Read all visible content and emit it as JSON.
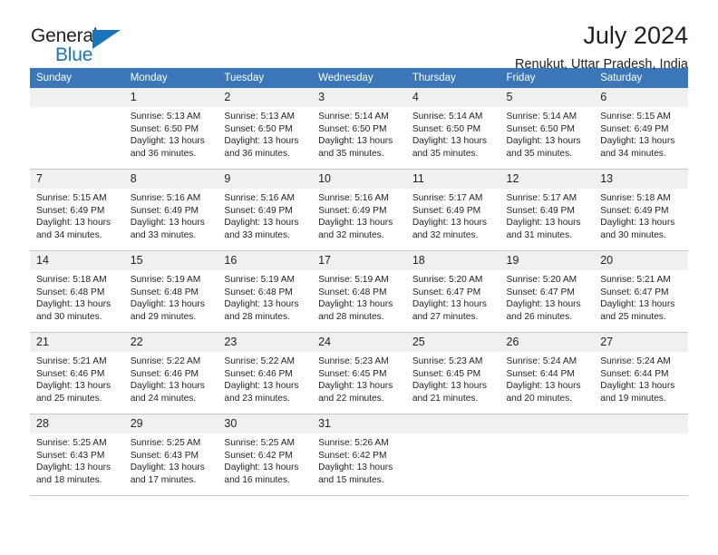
{
  "brand": {
    "name_top": "General",
    "name_bottom": "Blue",
    "triangle_color": "#1b75bb"
  },
  "header": {
    "title": "July 2024",
    "subtitle": "Renukut, Uttar Pradesh, India"
  },
  "theme": {
    "header_blue": "#3a76b8",
    "daynum_bg": "#f0f0f0",
    "grid_line": "#c8c8c8",
    "text": "#231f20"
  },
  "weekdays": [
    "Sunday",
    "Monday",
    "Tuesday",
    "Wednesday",
    "Thursday",
    "Friday",
    "Saturday"
  ],
  "labels": {
    "sunrise_prefix": "Sunrise:",
    "sunset_prefix": "Sunset:",
    "daylight_prefix": "Daylight:"
  },
  "weeks": [
    [
      {
        "day": ""
      },
      {
        "day": "1",
        "sunrise": "Sunrise: 5:13 AM",
        "sunset": "Sunset: 6:50 PM",
        "daylight_l1": "Daylight: 13 hours",
        "daylight_l2": "and 36 minutes."
      },
      {
        "day": "2",
        "sunrise": "Sunrise: 5:13 AM",
        "sunset": "Sunset: 6:50 PM",
        "daylight_l1": "Daylight: 13 hours",
        "daylight_l2": "and 36 minutes."
      },
      {
        "day": "3",
        "sunrise": "Sunrise: 5:14 AM",
        "sunset": "Sunset: 6:50 PM",
        "daylight_l1": "Daylight: 13 hours",
        "daylight_l2": "and 35 minutes."
      },
      {
        "day": "4",
        "sunrise": "Sunrise: 5:14 AM",
        "sunset": "Sunset: 6:50 PM",
        "daylight_l1": "Daylight: 13 hours",
        "daylight_l2": "and 35 minutes."
      },
      {
        "day": "5",
        "sunrise": "Sunrise: 5:14 AM",
        "sunset": "Sunset: 6:50 PM",
        "daylight_l1": "Daylight: 13 hours",
        "daylight_l2": "and 35 minutes."
      },
      {
        "day": "6",
        "sunrise": "Sunrise: 5:15 AM",
        "sunset": "Sunset: 6:49 PM",
        "daylight_l1": "Daylight: 13 hours",
        "daylight_l2": "and 34 minutes."
      }
    ],
    [
      {
        "day": "7",
        "sunrise": "Sunrise: 5:15 AM",
        "sunset": "Sunset: 6:49 PM",
        "daylight_l1": "Daylight: 13 hours",
        "daylight_l2": "and 34 minutes."
      },
      {
        "day": "8",
        "sunrise": "Sunrise: 5:16 AM",
        "sunset": "Sunset: 6:49 PM",
        "daylight_l1": "Daylight: 13 hours",
        "daylight_l2": "and 33 minutes."
      },
      {
        "day": "9",
        "sunrise": "Sunrise: 5:16 AM",
        "sunset": "Sunset: 6:49 PM",
        "daylight_l1": "Daylight: 13 hours",
        "daylight_l2": "and 33 minutes."
      },
      {
        "day": "10",
        "sunrise": "Sunrise: 5:16 AM",
        "sunset": "Sunset: 6:49 PM",
        "daylight_l1": "Daylight: 13 hours",
        "daylight_l2": "and 32 minutes."
      },
      {
        "day": "11",
        "sunrise": "Sunrise: 5:17 AM",
        "sunset": "Sunset: 6:49 PM",
        "daylight_l1": "Daylight: 13 hours",
        "daylight_l2": "and 32 minutes."
      },
      {
        "day": "12",
        "sunrise": "Sunrise: 5:17 AM",
        "sunset": "Sunset: 6:49 PM",
        "daylight_l1": "Daylight: 13 hours",
        "daylight_l2": "and 31 minutes."
      },
      {
        "day": "13",
        "sunrise": "Sunrise: 5:18 AM",
        "sunset": "Sunset: 6:49 PM",
        "daylight_l1": "Daylight: 13 hours",
        "daylight_l2": "and 30 minutes."
      }
    ],
    [
      {
        "day": "14",
        "sunrise": "Sunrise: 5:18 AM",
        "sunset": "Sunset: 6:48 PM",
        "daylight_l1": "Daylight: 13 hours",
        "daylight_l2": "and 30 minutes."
      },
      {
        "day": "15",
        "sunrise": "Sunrise: 5:19 AM",
        "sunset": "Sunset: 6:48 PM",
        "daylight_l1": "Daylight: 13 hours",
        "daylight_l2": "and 29 minutes."
      },
      {
        "day": "16",
        "sunrise": "Sunrise: 5:19 AM",
        "sunset": "Sunset: 6:48 PM",
        "daylight_l1": "Daylight: 13 hours",
        "daylight_l2": "and 28 minutes."
      },
      {
        "day": "17",
        "sunrise": "Sunrise: 5:19 AM",
        "sunset": "Sunset: 6:48 PM",
        "daylight_l1": "Daylight: 13 hours",
        "daylight_l2": "and 28 minutes."
      },
      {
        "day": "18",
        "sunrise": "Sunrise: 5:20 AM",
        "sunset": "Sunset: 6:47 PM",
        "daylight_l1": "Daylight: 13 hours",
        "daylight_l2": "and 27 minutes."
      },
      {
        "day": "19",
        "sunrise": "Sunrise: 5:20 AM",
        "sunset": "Sunset: 6:47 PM",
        "daylight_l1": "Daylight: 13 hours",
        "daylight_l2": "and 26 minutes."
      },
      {
        "day": "20",
        "sunrise": "Sunrise: 5:21 AM",
        "sunset": "Sunset: 6:47 PM",
        "daylight_l1": "Daylight: 13 hours",
        "daylight_l2": "and 25 minutes."
      }
    ],
    [
      {
        "day": "21",
        "sunrise": "Sunrise: 5:21 AM",
        "sunset": "Sunset: 6:46 PM",
        "daylight_l1": "Daylight: 13 hours",
        "daylight_l2": "and 25 minutes."
      },
      {
        "day": "22",
        "sunrise": "Sunrise: 5:22 AM",
        "sunset": "Sunset: 6:46 PM",
        "daylight_l1": "Daylight: 13 hours",
        "daylight_l2": "and 24 minutes."
      },
      {
        "day": "23",
        "sunrise": "Sunrise: 5:22 AM",
        "sunset": "Sunset: 6:46 PM",
        "daylight_l1": "Daylight: 13 hours",
        "daylight_l2": "and 23 minutes."
      },
      {
        "day": "24",
        "sunrise": "Sunrise: 5:23 AM",
        "sunset": "Sunset: 6:45 PM",
        "daylight_l1": "Daylight: 13 hours",
        "daylight_l2": "and 22 minutes."
      },
      {
        "day": "25",
        "sunrise": "Sunrise: 5:23 AM",
        "sunset": "Sunset: 6:45 PM",
        "daylight_l1": "Daylight: 13 hours",
        "daylight_l2": "and 21 minutes."
      },
      {
        "day": "26",
        "sunrise": "Sunrise: 5:24 AM",
        "sunset": "Sunset: 6:44 PM",
        "daylight_l1": "Daylight: 13 hours",
        "daylight_l2": "and 20 minutes."
      },
      {
        "day": "27",
        "sunrise": "Sunrise: 5:24 AM",
        "sunset": "Sunset: 6:44 PM",
        "daylight_l1": "Daylight: 13 hours",
        "daylight_l2": "and 19 minutes."
      }
    ],
    [
      {
        "day": "28",
        "sunrise": "Sunrise: 5:25 AM",
        "sunset": "Sunset: 6:43 PM",
        "daylight_l1": "Daylight: 13 hours",
        "daylight_l2": "and 18 minutes."
      },
      {
        "day": "29",
        "sunrise": "Sunrise: 5:25 AM",
        "sunset": "Sunset: 6:43 PM",
        "daylight_l1": "Daylight: 13 hours",
        "daylight_l2": "and 17 minutes."
      },
      {
        "day": "30",
        "sunrise": "Sunrise: 5:25 AM",
        "sunset": "Sunset: 6:42 PM",
        "daylight_l1": "Daylight: 13 hours",
        "daylight_l2": "and 16 minutes."
      },
      {
        "day": "31",
        "sunrise": "Sunrise: 5:26 AM",
        "sunset": "Sunset: 6:42 PM",
        "daylight_l1": "Daylight: 13 hours",
        "daylight_l2": "and 15 minutes."
      },
      {
        "day": ""
      },
      {
        "day": ""
      },
      {
        "day": ""
      }
    ]
  ]
}
